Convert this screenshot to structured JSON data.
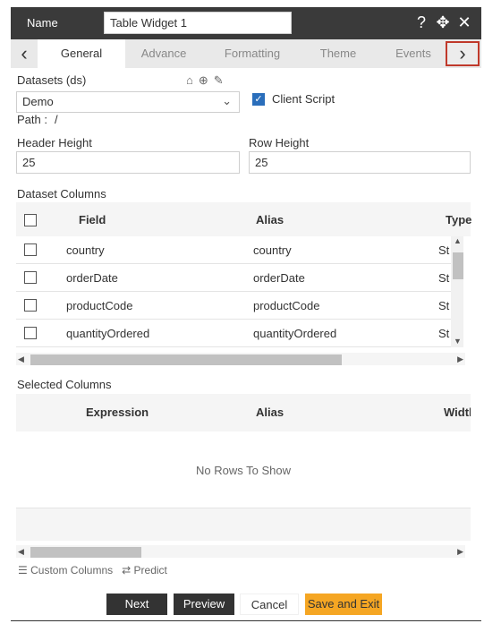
{
  "header": {
    "name_label": "Name",
    "name_value": "Table Widget 1",
    "help_icon": "?",
    "move_icon": "✥",
    "close_icon": "✕"
  },
  "tabs": {
    "prev": "‹",
    "next": "›",
    "items": [
      "General",
      "Advance",
      "Formatting",
      "Theme",
      "Events"
    ],
    "active": "General"
  },
  "datasets": {
    "label": "Datasets (ds)",
    "selected": "Demo",
    "path_label": "Path :",
    "path_value": "/",
    "icons": [
      "home-icon",
      "add-circle-icon",
      "edit-icon"
    ]
  },
  "client_script": {
    "label": "Client Script",
    "checked": true
  },
  "header_height": {
    "label": "Header Height",
    "value": "25"
  },
  "row_height": {
    "label": "Row Height",
    "value": "25"
  },
  "dataset_columns": {
    "title": "Dataset Columns",
    "headers": [
      "Field",
      "Alias",
      "Type"
    ],
    "rows": [
      {
        "field": "country",
        "alias": "country",
        "type": "St"
      },
      {
        "field": "orderDate",
        "alias": "orderDate",
        "type": "St"
      },
      {
        "field": "productCode",
        "alias": "productCode",
        "type": "St"
      },
      {
        "field": "quantityOrdered",
        "alias": "quantityOrdered",
        "type": "St"
      }
    ]
  },
  "selected_columns": {
    "title": "Selected Columns",
    "headers": [
      "Expression",
      "Alias",
      "Width"
    ],
    "empty_message": "No Rows To Show"
  },
  "footer": {
    "custom_columns": "Custom Columns",
    "predict": "Predict"
  },
  "buttons": {
    "next": "Next",
    "preview": "Preview",
    "cancel": "Cancel",
    "save_exit": "Save and Exit"
  },
  "colors": {
    "header_bg": "#3a3a3a",
    "accent_orange": "#f5a623",
    "checkbox_blue": "#2a6ebb",
    "highlight_red": "#c0392b"
  }
}
